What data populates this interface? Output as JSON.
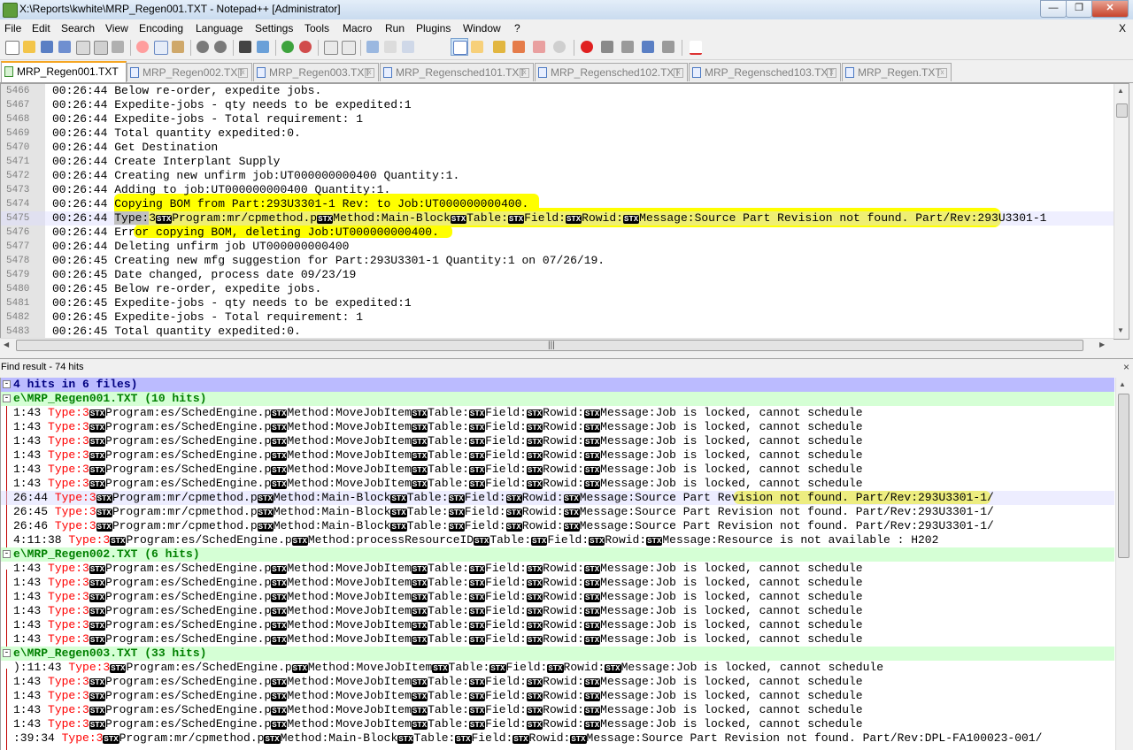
{
  "window": {
    "title": "X:\\Reports\\kwhite\\MRP_Regen001.TXT - Notepad++ [Administrator]",
    "controls": {
      "minimize": "—",
      "maximize": "❐",
      "close": "✕"
    }
  },
  "menu": {
    "items": [
      "File",
      "Edit",
      "Search",
      "View",
      "Encoding",
      "Language",
      "Settings",
      "Tools",
      "Macro",
      "Run",
      "Plugins",
      "Window",
      "?"
    ],
    "close_doc": "X"
  },
  "tabs": [
    {
      "label": "MRP_Regen001.TXT",
      "active": true
    },
    {
      "label": "MRP_Regen002.TXT",
      "active": false
    },
    {
      "label": "MRP_Regen003.TXT",
      "active": false
    },
    {
      "label": "MRP_Regensched101.TXT",
      "active": false
    },
    {
      "label": "MRP_Regensched102.TXT",
      "active": false
    },
    {
      "label": "MRP_Regensched103.TXT",
      "active": false
    },
    {
      "label": "MRP_Regen.TXT",
      "active": false
    }
  ],
  "editor": {
    "lines": [
      {
        "num": "5466",
        "text": "00:26:44 Below re-order, expedite jobs."
      },
      {
        "num": "5467",
        "text": "00:26:44 Expedite-jobs - qty needs to be expedited:1"
      },
      {
        "num": "5468",
        "text": "00:26:44 Expedite-jobs - Total requirement: 1"
      },
      {
        "num": "5469",
        "text": "00:26:44 Total quantity expedited:0."
      },
      {
        "num": "5470",
        "text": "00:26:44 Get Destination"
      },
      {
        "num": "5471",
        "text": "00:26:44 Create Interplant Supply"
      },
      {
        "num": "5472",
        "text": "00:26:44 Creating new unfirm job:UT000000000400 Quantity:1."
      },
      {
        "num": "5473",
        "text": "00:26:44 Adding to job:UT000000000400 Quantity:1."
      },
      {
        "num": "5474",
        "text": "00:26:44 Copying BOM from Part:293U3301-1 Rev: to Job:UT000000000400."
      },
      {
        "num": "5475",
        "text": "00:26:44 "
      },
      {
        "num": "5476",
        "text": "00:26:44 Error copying BOM, deleting Job:UT000000000400."
      },
      {
        "num": "5477",
        "text": "00:26:44 Deleting unfirm job UT000000000400"
      },
      {
        "num": "5478",
        "text": "00:26:45 Creating new mfg suggestion for Part:293U3301-1 Quantity:1 on 07/26/19."
      },
      {
        "num": "5479",
        "text": "00:26:45 Date changed, process date 09/23/19"
      },
      {
        "num": "5480",
        "text": "00:26:45 Below re-order, expedite jobs."
      },
      {
        "num": "5481",
        "text": "00:26:45 Expedite-jobs - qty needs to be expedited:1"
      },
      {
        "num": "5482",
        "text": "00:26:45 Expedite-jobs - Total requirement: 1"
      },
      {
        "num": "5483",
        "text": "00:26:45 Total quantity expedited:0."
      }
    ],
    "line5475": {
      "type_sel": "Type:",
      "type_num": "3",
      "stx": "STX",
      "segments": [
        "Program:mr/cpmethod.p",
        "Method:Main-Block",
        "Table:",
        "Field:",
        "Rowid:",
        "Message:Source Part Revision not found. Part/Rev:293U3301-1"
      ]
    }
  },
  "find": {
    "panel_title": "Find result - 74 hits",
    "close": "×",
    "stx": "STX",
    "search_line": "4 hits in 6 files)",
    "files": [
      {
        "header": "e\\MRP_Regen001.TXT (10 hits)"
      },
      {
        "header": "e\\MRP_Regen002.TXT (6 hits)"
      },
      {
        "header": "e\\MRP_Regen003.TXT (33 hits)"
      }
    ],
    "sched": [
      "Program:es/SchedEngine.p",
      "Method:MoveJobItem",
      "Table:",
      "Field:",
      "Rowid:",
      "Message:Job is locked, cannot schedule"
    ],
    "cpm": [
      "Program:mr/cpmethod.p",
      "Method:Main-Block",
      "Table:",
      "Field:",
      "Rowid:",
      "Message:Source Part Revision not found. Part/Rev:293U3301-1/"
    ],
    "cpm_kw": "Message:Source",
    "cpm_kw_rest": " Part Revision not found. Part/Rev:",
    "cpm_kw_tail": "293U3301-1/",
    "res": [
      "Program:es/SchedEngine.p",
      "Method:processResourceID",
      "Table:",
      "Field:",
      "Rowid:",
      "Message:Resource is not available : H202"
    ],
    "cpm3": [
      "Program:mr/cpmethod.p",
      "Method:Main-Block",
      "Table:",
      "Field:",
      "Rowid:",
      "Message:Source Part Revision not found. Part/Rev:DPL-FA100023-001/"
    ],
    "type_label": "Type:3",
    "prefixes": {
      "r1": "1:43 ",
      "r7": "26:44 ",
      "r8": "26:45 ",
      "r9": "26:46 ",
      "r10": "4:11:38 ",
      "g2": "1:43 ",
      "g3a": "):11:43 ",
      "g3b": "1:43 ",
      "g3e": ":39:34 "
    }
  }
}
